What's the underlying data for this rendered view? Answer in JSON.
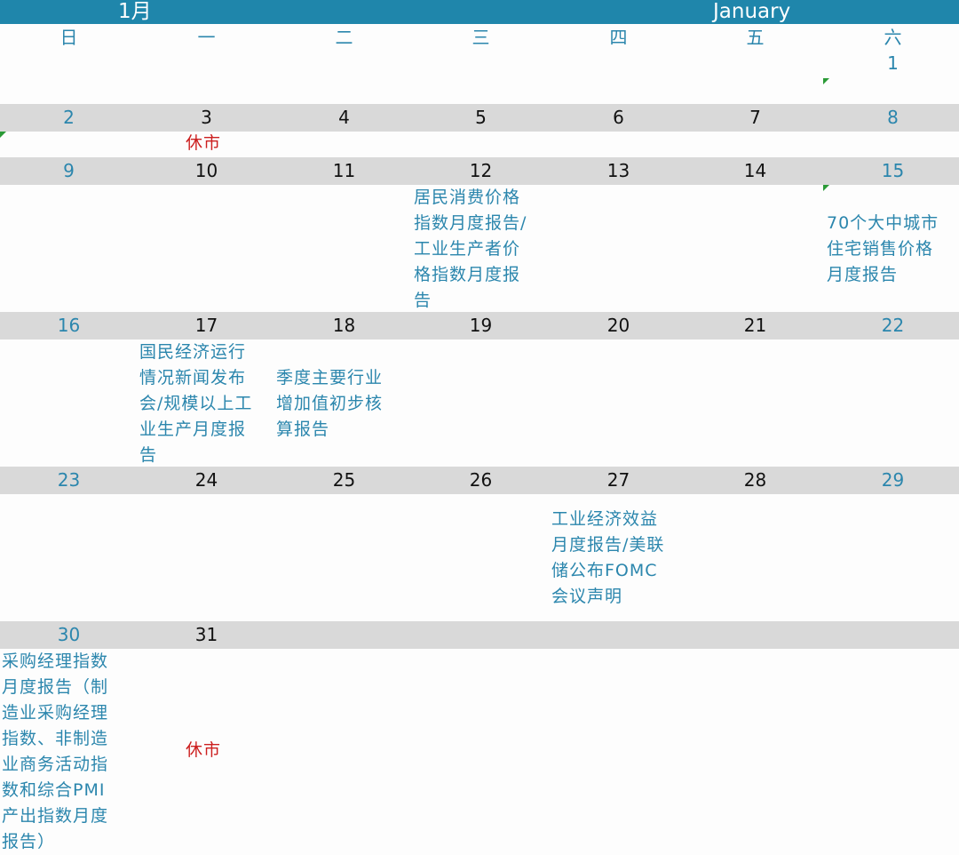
{
  "header": {
    "month_cn": "1月",
    "month_en": "January"
  },
  "weekdays": [
    "日",
    "一",
    "二",
    "三",
    "四",
    "五",
    "六"
  ],
  "day_colors": [
    "#2b86ad",
    "#111111",
    "#111111",
    "#111111",
    "#111111",
    "#111111",
    "#2b86ad"
  ],
  "weeks": [
    {
      "days": [
        "",
        "",
        "",
        "",
        "",
        "",
        "1"
      ]
    },
    {
      "days": [
        "2",
        "3",
        "4",
        "5",
        "6",
        "7",
        "8"
      ]
    },
    {
      "days": [
        "9",
        "10",
        "11",
        "12",
        "13",
        "14",
        "15"
      ]
    },
    {
      "days": [
        "16",
        "17",
        "18",
        "19",
        "20",
        "21",
        "22"
      ]
    },
    {
      "days": [
        "23",
        "24",
        "25",
        "26",
        "27",
        "28",
        "29"
      ]
    },
    {
      "days": [
        "30",
        "31",
        "",
        "",
        "",
        "",
        ""
      ]
    }
  ],
  "events": {
    "jan3": {
      "lines": [
        "休市"
      ]
    },
    "jan12": {
      "lines": [
        "居民消费价格",
        "指数月度报告/",
        "工业生产者价",
        "格指数月度报",
        "告"
      ]
    },
    "jan15": {
      "lines": [
        "70个大中城市",
        "住宅销售价格",
        "月度报告"
      ]
    },
    "jan17": {
      "lines": [
        "国民经济运行",
        "情况新闻发布",
        "会/规模以上工",
        "业生产月度报",
        "告"
      ]
    },
    "jan18": {
      "lines": [
        "季度主要行业",
        "增加值初步核",
        "算报告"
      ]
    },
    "jan27": {
      "lines": [
        "工业经济效益",
        "月度报告/美联",
        "储公布FOMC",
        "会议声明"
      ]
    },
    "jan30": {
      "lines": [
        "采购经理指数",
        "月度报告（制",
        "造业采购经理",
        "指数、非制造",
        "业商务活动指",
        "数和综合PMI",
        "产出指数月度",
        "报告）"
      ]
    },
    "jan31": {
      "lines": [
        "休市"
      ]
    }
  },
  "colors": {
    "header_bg": "#1f86ab",
    "accent": "#2b86ad",
    "closed": "#cc1f1f",
    "band": "#d9d9d9"
  }
}
